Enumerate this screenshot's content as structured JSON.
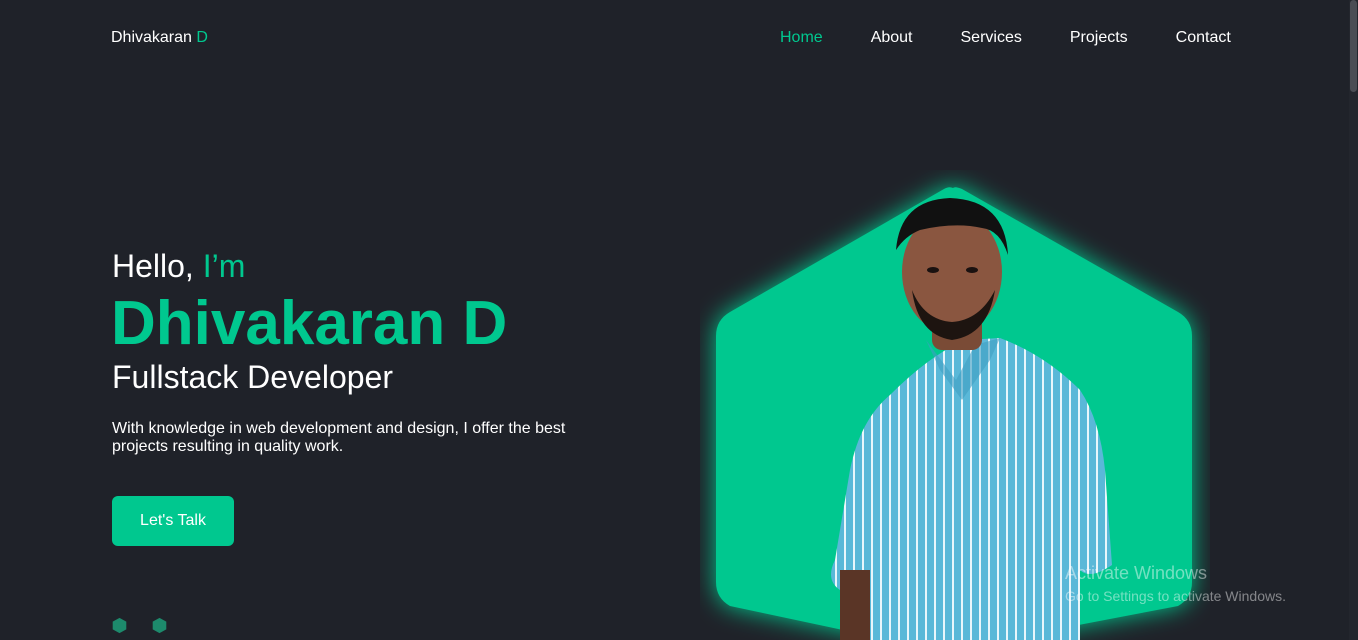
{
  "header": {
    "logo_first": "Dhivakaran",
    "logo_accent": "D",
    "nav": [
      {
        "label": "Home",
        "active": true
      },
      {
        "label": "About",
        "active": false
      },
      {
        "label": "Services",
        "active": false
      },
      {
        "label": "Projects",
        "active": false
      },
      {
        "label": "Contact",
        "active": false
      }
    ]
  },
  "hero": {
    "hello": "Hello,",
    "hello_accent": "I’m",
    "name": "Dhivakaran D",
    "role": "Fullstack Developer",
    "description": "With knowledge in web development and design, I offer the best projects resulting in quality work.",
    "cta_label": "Let's Talk"
  },
  "social_icons": [
    "hexagon-icon",
    "hexagon-icon"
  ],
  "watermark": {
    "line1": "Activate Windows",
    "line2": "Go to Settings to activate Windows."
  },
  "colors": {
    "background": "#1f2229",
    "accent": "#00c88f",
    "text": "#ffffff"
  }
}
